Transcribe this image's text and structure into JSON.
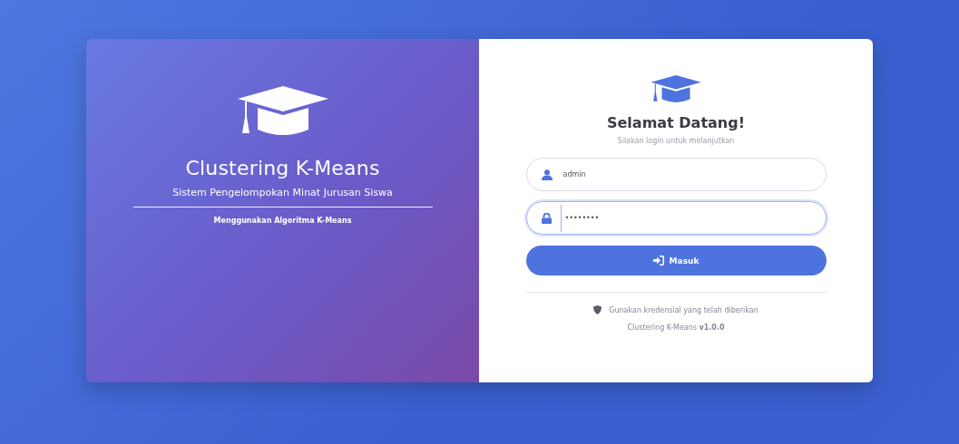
{
  "brand": {
    "title": "Clustering K-Means",
    "subtitle": "Sistem Pengelompokan Minat Jurusan Siswa",
    "caption": "Menggunakan Algoritma K-Means"
  },
  "login": {
    "title": "Selamat Datang!",
    "subtitle": "Silakan login untuk melanjutkan",
    "fields": [
      {
        "kind": "text",
        "value": "admin",
        "focused": false
      },
      {
        "kind": "password",
        "value": "••••••••",
        "focused": true
      }
    ],
    "button": "Masuk",
    "note": "Gunakan kredensial yang telah diberikan",
    "footer": "Clustering K-Means  **v1.0.0**"
  }
}
